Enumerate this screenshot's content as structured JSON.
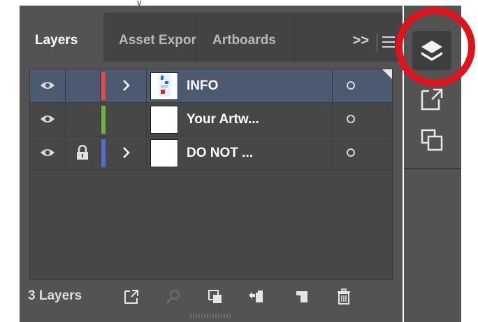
{
  "window": {
    "title_fragment": "y"
  },
  "tabs": [
    {
      "label": "Layers",
      "active": true
    },
    {
      "label": "Asset Export",
      "active": false
    },
    {
      "label": "Artboards",
      "active": false
    }
  ],
  "tab_overflow_label": ">>",
  "layers": [
    {
      "name": "INFO",
      "visible": true,
      "locked": false,
      "expandable": true,
      "color": "#e34b4b",
      "selected": true
    },
    {
      "name": "Your Artw...",
      "visible": true,
      "locked": false,
      "expandable": false,
      "color": "#6fb33f",
      "selected": false
    },
    {
      "name": "DO NOT ...",
      "visible": true,
      "locked": true,
      "expandable": true,
      "color": "#4f6fcf",
      "selected": false
    }
  ],
  "footer": {
    "layer_count": "3 Layers"
  },
  "toolbar": {
    "buttons": [
      {
        "name": "layers-icon",
        "active": true
      },
      {
        "name": "export-icon",
        "active": false
      },
      {
        "name": "artboards-icon",
        "active": false
      }
    ]
  },
  "colors": {
    "highlight": "#e0121b",
    "selected_row": "#4b5a70",
    "panel": "#535353"
  }
}
